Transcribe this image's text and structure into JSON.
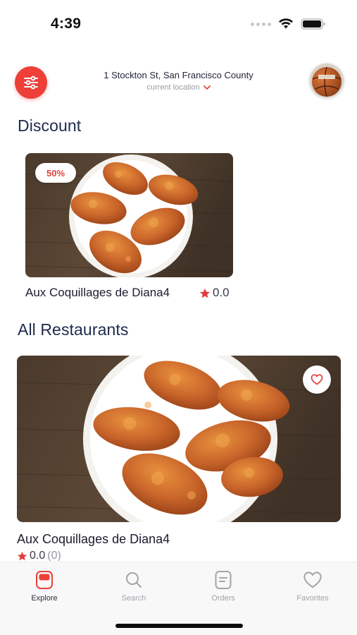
{
  "status_bar": {
    "time": "4:39"
  },
  "header": {
    "filter_icon": "sliders-icon",
    "address": "1 Stockton St, San Francisco County",
    "location_label": "current location",
    "avatar_icon": "basketball-avatar"
  },
  "discount": {
    "title": "Discount",
    "card": {
      "badge": "50%",
      "name": "Aux Coquillages de Diana4",
      "rating": "0.0"
    }
  },
  "restaurants": {
    "title": "All Restaurants",
    "items": [
      {
        "name": "Aux Coquillages de Diana4",
        "rating": "0.0",
        "count": "(0)",
        "favorite_icon": "heart-icon"
      }
    ]
  },
  "tabs": [
    {
      "label": "Explore",
      "icon": "explore-icon",
      "active": true
    },
    {
      "label": "Search",
      "icon": "search-icon",
      "active": false
    },
    {
      "label": "Orders",
      "icon": "orders-icon",
      "active": false
    },
    {
      "label": "Favorites",
      "icon": "heart-icon",
      "active": false
    }
  ],
  "colors": {
    "accent": "#ee3f38",
    "heading": "#1d2a4b",
    "inactive": "#a3a3ab"
  }
}
